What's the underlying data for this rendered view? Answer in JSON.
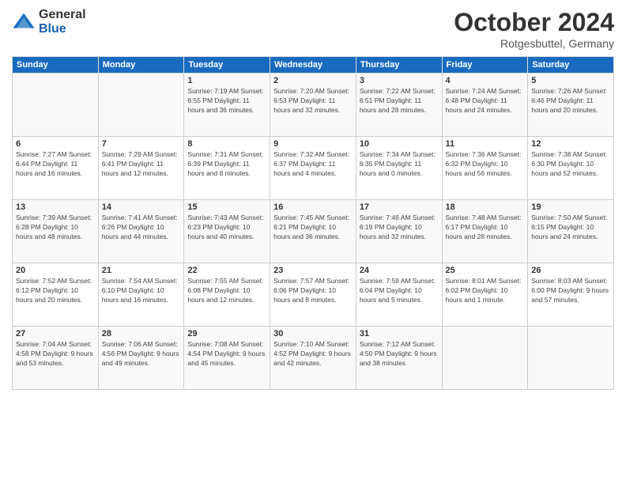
{
  "logo": {
    "general": "General",
    "blue": "Blue"
  },
  "title": "October 2024",
  "location": "Rotgesbuttel, Germany",
  "days_header": [
    "Sunday",
    "Monday",
    "Tuesday",
    "Wednesday",
    "Thursday",
    "Friday",
    "Saturday"
  ],
  "weeks": [
    [
      {
        "day": "",
        "info": ""
      },
      {
        "day": "",
        "info": ""
      },
      {
        "day": "1",
        "info": "Sunrise: 7:19 AM\nSunset: 6:55 PM\nDaylight: 11 hours\nand 36 minutes."
      },
      {
        "day": "2",
        "info": "Sunrise: 7:20 AM\nSunset: 6:53 PM\nDaylight: 11 hours\nand 32 minutes."
      },
      {
        "day": "3",
        "info": "Sunrise: 7:22 AM\nSunset: 6:51 PM\nDaylight: 11 hours\nand 28 minutes."
      },
      {
        "day": "4",
        "info": "Sunrise: 7:24 AM\nSunset: 6:48 PM\nDaylight: 11 hours\nand 24 minutes."
      },
      {
        "day": "5",
        "info": "Sunrise: 7:26 AM\nSunset: 6:46 PM\nDaylight: 11 hours\nand 20 minutes."
      }
    ],
    [
      {
        "day": "6",
        "info": "Sunrise: 7:27 AM\nSunset: 6:44 PM\nDaylight: 11 hours\nand 16 minutes."
      },
      {
        "day": "7",
        "info": "Sunrise: 7:29 AM\nSunset: 6:41 PM\nDaylight: 11 hours\nand 12 minutes."
      },
      {
        "day": "8",
        "info": "Sunrise: 7:31 AM\nSunset: 6:39 PM\nDaylight: 11 hours\nand 8 minutes."
      },
      {
        "day": "9",
        "info": "Sunrise: 7:32 AM\nSunset: 6:37 PM\nDaylight: 11 hours\nand 4 minutes."
      },
      {
        "day": "10",
        "info": "Sunrise: 7:34 AM\nSunset: 6:35 PM\nDaylight: 11 hours\nand 0 minutes."
      },
      {
        "day": "11",
        "info": "Sunrise: 7:36 AM\nSunset: 6:32 PM\nDaylight: 10 hours\nand 56 minutes."
      },
      {
        "day": "12",
        "info": "Sunrise: 7:38 AM\nSunset: 6:30 PM\nDaylight: 10 hours\nand 52 minutes."
      }
    ],
    [
      {
        "day": "13",
        "info": "Sunrise: 7:39 AM\nSunset: 6:28 PM\nDaylight: 10 hours\nand 48 minutes."
      },
      {
        "day": "14",
        "info": "Sunrise: 7:41 AM\nSunset: 6:26 PM\nDaylight: 10 hours\nand 44 minutes."
      },
      {
        "day": "15",
        "info": "Sunrise: 7:43 AM\nSunset: 6:23 PM\nDaylight: 10 hours\nand 40 minutes."
      },
      {
        "day": "16",
        "info": "Sunrise: 7:45 AM\nSunset: 6:21 PM\nDaylight: 10 hours\nand 36 minutes."
      },
      {
        "day": "17",
        "info": "Sunrise: 7:46 AM\nSunset: 6:19 PM\nDaylight: 10 hours\nand 32 minutes."
      },
      {
        "day": "18",
        "info": "Sunrise: 7:48 AM\nSunset: 6:17 PM\nDaylight: 10 hours\nand 28 minutes."
      },
      {
        "day": "19",
        "info": "Sunrise: 7:50 AM\nSunset: 6:15 PM\nDaylight: 10 hours\nand 24 minutes."
      }
    ],
    [
      {
        "day": "20",
        "info": "Sunrise: 7:52 AM\nSunset: 6:12 PM\nDaylight: 10 hours\nand 20 minutes."
      },
      {
        "day": "21",
        "info": "Sunrise: 7:54 AM\nSunset: 6:10 PM\nDaylight: 10 hours\nand 16 minutes."
      },
      {
        "day": "22",
        "info": "Sunrise: 7:55 AM\nSunset: 6:08 PM\nDaylight: 10 hours\nand 12 minutes."
      },
      {
        "day": "23",
        "info": "Sunrise: 7:57 AM\nSunset: 6:06 PM\nDaylight: 10 hours\nand 8 minutes."
      },
      {
        "day": "24",
        "info": "Sunrise: 7:59 AM\nSunset: 6:04 PM\nDaylight: 10 hours\nand 5 minutes."
      },
      {
        "day": "25",
        "info": "Sunrise: 8:01 AM\nSunset: 6:02 PM\nDaylight: 10 hours\nand 1 minute."
      },
      {
        "day": "26",
        "info": "Sunrise: 8:03 AM\nSunset: 6:00 PM\nDaylight: 9 hours\nand 57 minutes."
      }
    ],
    [
      {
        "day": "27",
        "info": "Sunrise: 7:04 AM\nSunset: 4:58 PM\nDaylight: 9 hours\nand 53 minutes."
      },
      {
        "day": "28",
        "info": "Sunrise: 7:06 AM\nSunset: 4:56 PM\nDaylight: 9 hours\nand 49 minutes."
      },
      {
        "day": "29",
        "info": "Sunrise: 7:08 AM\nSunset: 4:54 PM\nDaylight: 9 hours\nand 45 minutes."
      },
      {
        "day": "30",
        "info": "Sunrise: 7:10 AM\nSunset: 4:52 PM\nDaylight: 9 hours\nand 42 minutes."
      },
      {
        "day": "31",
        "info": "Sunrise: 7:12 AM\nSunset: 4:50 PM\nDaylight: 9 hours\nand 38 minutes."
      },
      {
        "day": "",
        "info": ""
      },
      {
        "day": "",
        "info": ""
      }
    ]
  ]
}
